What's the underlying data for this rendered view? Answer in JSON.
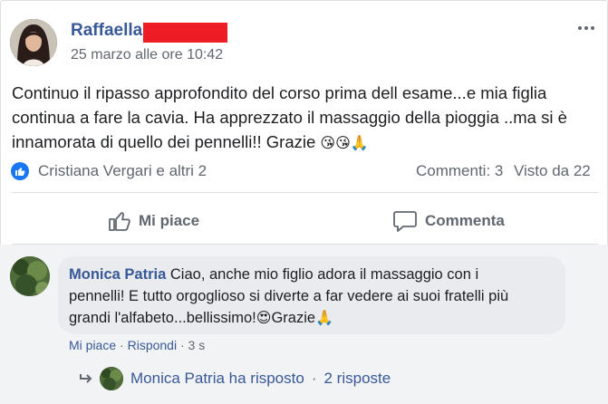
{
  "post": {
    "author": "Raffaella",
    "timestamp": "25 marzo alle ore 10:42",
    "text_lines": [
      "Continuo il ripasso approfondito del corso prima dell esame...e mia figlia",
      "continua a fare la cavia. Ha apprezzato il massaggio della pioggia ..ma si è",
      "innamorata di quello dei pennelli!! Grazie"
    ],
    "text_emojis": "😘😘🙏",
    "reactors": "Cristiana Vergari e altri 2",
    "comments_count": "Commenti: 3",
    "views_count": "Visto da 22"
  },
  "actions": {
    "like_label": "Mi piace",
    "comment_label": "Commenta"
  },
  "comment": {
    "author": "Monica Patria",
    "line1": " Ciao, anche mio figlio adora il massaggio con i",
    "line2": "pennelli! E tutto orgoglioso si diverte a far vedere ai suoi fratelli più",
    "line3_text": "grandi l'alfabeto...bellissimo!",
    "line3_emoji1": "😍",
    "line3_word": "Grazie",
    "line3_emoji2": "🙏",
    "like_link": "Mi piace",
    "reply_link": "Rispondi",
    "time": "3 s",
    "separator": " · "
  },
  "reply_summary": {
    "replier": "Monica Patria ha risposto",
    "separator": " · ",
    "count": "2 risposte"
  },
  "icons": {
    "menu": "more-horizontal-icon",
    "like_badge": "thumbs-up-icon",
    "like_action": "thumbs-up-outline-icon",
    "comment_action": "speech-bubble-icon",
    "reply_arrow": "reply-arrow-icon"
  },
  "colors": {
    "link": "#385898",
    "like_badge": "#1877f2",
    "redaction": "#ee1c24",
    "muted": "#606770"
  }
}
